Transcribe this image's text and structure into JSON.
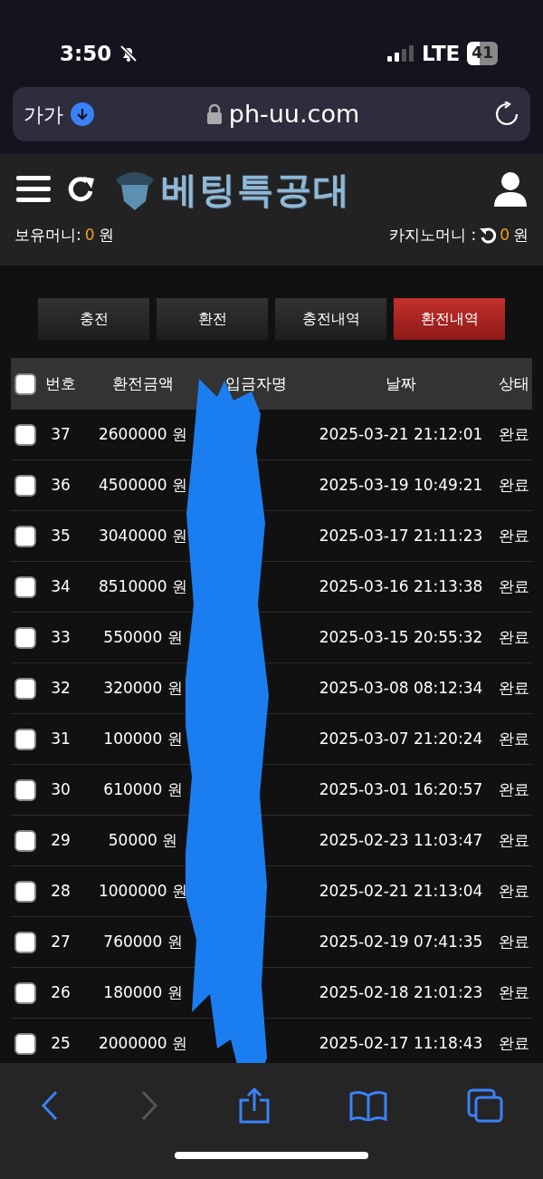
{
  "status_bar": {
    "time": "3:50",
    "network": "LTE",
    "battery": "41"
  },
  "browser": {
    "text_size": "가가",
    "url": "ph-uu.com"
  },
  "header": {
    "logo": "베팅특공대"
  },
  "balances": [
    {
      "label": "보유머니:",
      "amount": "0",
      "unit": "원",
      "kind": "plain"
    },
    {
      "label": "카지노머니 :",
      "amount": "0",
      "unit": "원",
      "kind": "refresh"
    }
  ],
  "tabs": [
    {
      "label": "충전",
      "selected": false
    },
    {
      "label": "환전",
      "selected": false
    },
    {
      "label": "충전내역",
      "selected": false
    },
    {
      "label": "환전내역",
      "selected": true
    }
  ],
  "table": {
    "select_all": {
      "checked": false
    },
    "columns": [
      "번호",
      "환전금액",
      "입금자명",
      "날짜",
      "상태"
    ],
    "rows": [
      {
        "checked": false,
        "number": "37",
        "amount": "2600000 원",
        "date": "2025-03-21 21:12:01",
        "status": "완료"
      },
      {
        "checked": false,
        "number": "36",
        "amount": "4500000 원",
        "date": "2025-03-19 10:49:21",
        "status": "완료"
      },
      {
        "checked": false,
        "number": "35",
        "amount": "3040000 원",
        "date": "2025-03-17 21:11:23",
        "status": "완료"
      },
      {
        "checked": false,
        "number": "34",
        "amount": "8510000 원",
        "date": "2025-03-16 21:13:38",
        "status": "완료"
      },
      {
        "checked": false,
        "number": "33",
        "amount": "550000 원",
        "date": "2025-03-15 20:55:32",
        "status": "완료"
      },
      {
        "checked": false,
        "number": "32",
        "amount": "320000 원",
        "date": "2025-03-08 08:12:34",
        "status": "완료"
      },
      {
        "checked": false,
        "number": "31",
        "amount": "100000 원",
        "date": "2025-03-07 21:20:24",
        "status": "완료"
      },
      {
        "checked": false,
        "number": "30",
        "amount": "610000 원",
        "date": "2025-03-01 16:20:57",
        "status": "완료"
      },
      {
        "checked": false,
        "number": "29",
        "amount": "50000 원",
        "date": "2025-02-23 11:03:47",
        "status": "완료"
      },
      {
        "checked": false,
        "number": "28",
        "amount": "1000000 원",
        "date": "2025-02-21 21:13:04",
        "status": "완료"
      },
      {
        "checked": false,
        "number": "27",
        "amount": "760000 원",
        "date": "2025-02-19 07:41:35",
        "status": "완료"
      },
      {
        "checked": false,
        "number": "26",
        "amount": "180000 원",
        "date": "2025-02-18 21:01:23",
        "status": "완료"
      },
      {
        "checked": false,
        "number": "25",
        "amount": "2000000 원",
        "date": "2025-02-17 11:18:43",
        "status": "완료"
      }
    ]
  }
}
